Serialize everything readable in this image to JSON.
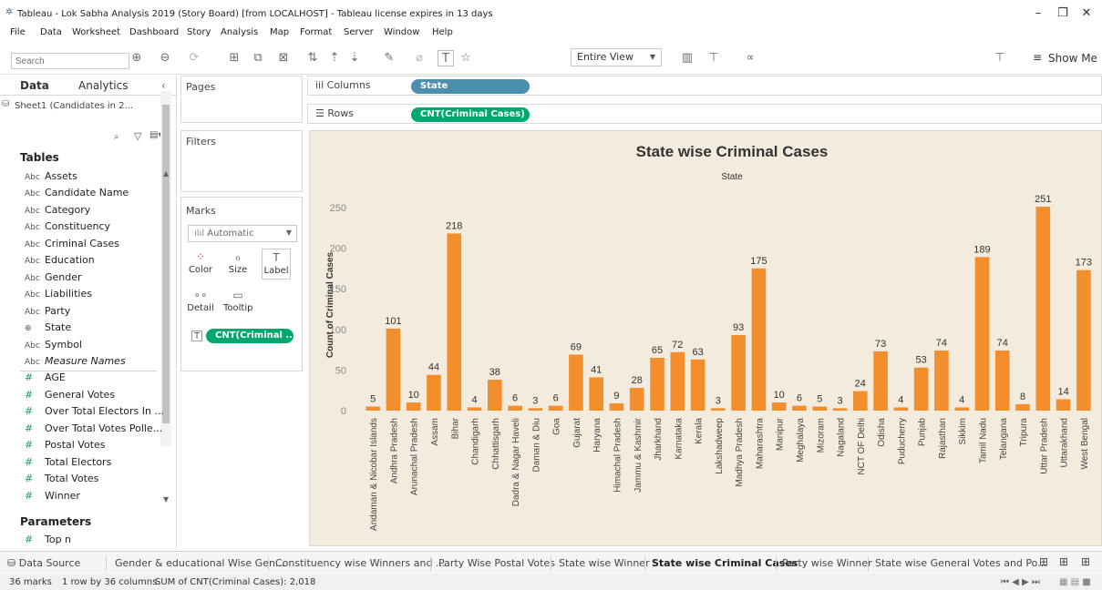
{
  "window": {
    "title": "Tableau - Lok Sabha Analysis 2019 (Story Board) [from LOCALHOST] - Tableau license expires in 13 days",
    "minimize": "–",
    "maximize": "❐",
    "close": "✕"
  },
  "menu": [
    "File",
    "Data",
    "Worksheet",
    "Dashboard",
    "Story",
    "Analysis",
    "Map",
    "Format",
    "Server",
    "Window",
    "Help"
  ],
  "toolbar": {
    "view_mode": "Entire View",
    "show_me": "Show Me"
  },
  "left_pane": {
    "tabs": [
      "Data",
      "Analytics"
    ],
    "data_source": "Sheet1 (Candidates in 2...",
    "search_placeholder": "Search",
    "tables_heading": "Tables",
    "fields": [
      {
        "type": "Abc",
        "name": "Assets"
      },
      {
        "type": "Abc",
        "name": "Candidate Name"
      },
      {
        "type": "Abc",
        "name": "Category"
      },
      {
        "type": "Abc",
        "name": "Constituency"
      },
      {
        "type": "Abc",
        "name": "Criminal Cases"
      },
      {
        "type": "Abc",
        "name": "Education"
      },
      {
        "type": "Abc",
        "name": "Gender"
      },
      {
        "type": "Abc",
        "name": "Liabilities"
      },
      {
        "type": "Abc",
        "name": "Party"
      },
      {
        "type": "geo",
        "name": "State"
      },
      {
        "type": "Abc",
        "name": "Symbol"
      },
      {
        "type": "Abc",
        "name": "Measure Names"
      },
      {
        "type": "#",
        "name": "AGE"
      },
      {
        "type": "#",
        "name": "General Votes"
      },
      {
        "type": "#",
        "name": "Over Total Electors In ..."
      },
      {
        "type": "#",
        "name": "Over Total Votes Polle..."
      },
      {
        "type": "#",
        "name": "Postal Votes"
      },
      {
        "type": "#",
        "name": "Total Electors"
      },
      {
        "type": "#",
        "name": "Total Votes"
      },
      {
        "type": "#",
        "name": "Winner"
      }
    ],
    "parameters_heading": "Parameters",
    "parameters": [
      {
        "type": "#",
        "name": "Top n"
      }
    ]
  },
  "shelves": {
    "pages": "Pages",
    "filters": "Filters",
    "columns_label": "Columns",
    "columns_pill": "State",
    "rows_label": "Rows",
    "rows_pill": "CNT(Criminal Cases)"
  },
  "marks": {
    "heading": "Marks",
    "type": "Automatic",
    "buttons": [
      "Color",
      "Size",
      "Label",
      "Detail",
      "Tooltip"
    ],
    "pill": "CNT(Criminal ..."
  },
  "chart_data": {
    "type": "bar",
    "title": "State wise Criminal Cases",
    "x_header": "State",
    "ylabel": "Count of Criminal Cases",
    "ylim": [
      0,
      260
    ],
    "yticks": [
      0,
      50,
      100,
      150,
      200,
      250
    ],
    "categories": [
      "Andaman & Nicobar Islands",
      "Andhra Pradesh",
      "Arunachal Pradesh",
      "Assam",
      "Bihar",
      "Chandigarh",
      "Chhattisgarh",
      "Dadra & Nagar Haveli",
      "Daman & Diu",
      "Goa",
      "Gujarat",
      "Haryana",
      "Himachal Pradesh",
      "Jammu & Kashmir",
      "Jharkhand",
      "Karnataka",
      "Kerala",
      "Lakshadweep",
      "Madhya Pradesh",
      "Maharashtra",
      "Manipur",
      "Meghalaya",
      "Mizoram",
      "Nagaland",
      "NCT OF Delhi",
      "Odisha",
      "Puducherry",
      "Punjab",
      "Rajasthan",
      "Sikkim",
      "Tamil Nadu",
      "Telangana",
      "Tripura",
      "Uttar Pradesh",
      "Uttarakhand",
      "West Bengal"
    ],
    "values": [
      5,
      101,
      10,
      44,
      218,
      4,
      38,
      6,
      3,
      6,
      69,
      41,
      9,
      28,
      65,
      72,
      63,
      3,
      93,
      175,
      10,
      6,
      5,
      3,
      24,
      73,
      4,
      53,
      74,
      4,
      189,
      74,
      8,
      251,
      14,
      173
    ],
    "bar_color": "#f28e2b"
  },
  "sheet_tabs": [
    "Data Source",
    "Gender & educational Wise Gen...",
    "Constituency wise Winners and ...",
    "Party Wise Postal Votes",
    "State wise Winner",
    "State wise Criminal Cases",
    "Party wise Winner",
    "State wise General Votes and Po..."
  ],
  "status": {
    "marks": "36 marks",
    "dims": "1 row by 36 columns",
    "sum": "SUM of CNT(Criminal Cases): 2,018"
  }
}
